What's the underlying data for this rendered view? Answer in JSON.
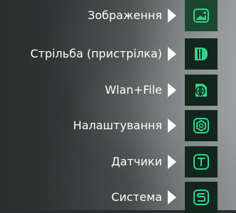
{
  "menu": {
    "items": [
      {
        "label": "Зображення",
        "icon": "image-icon",
        "active": true
      },
      {
        "label": "Стрільба (пристрілка)",
        "icon": "shooting-icon",
        "active": false
      },
      {
        "label": "Wlan+File",
        "icon": "wlan-file-icon",
        "active": false
      },
      {
        "label": "Налаштування",
        "icon": "settings-icon",
        "active": false
      },
      {
        "label": "Датчики",
        "icon": "sensors-icon",
        "active": false
      },
      {
        "label": "Система",
        "icon": "system-icon",
        "active": false
      }
    ]
  },
  "colors": {
    "text": "#ffffff",
    "accent": "#2fd48a",
    "tile": "#12261d",
    "tile_active": "#1d4733"
  }
}
